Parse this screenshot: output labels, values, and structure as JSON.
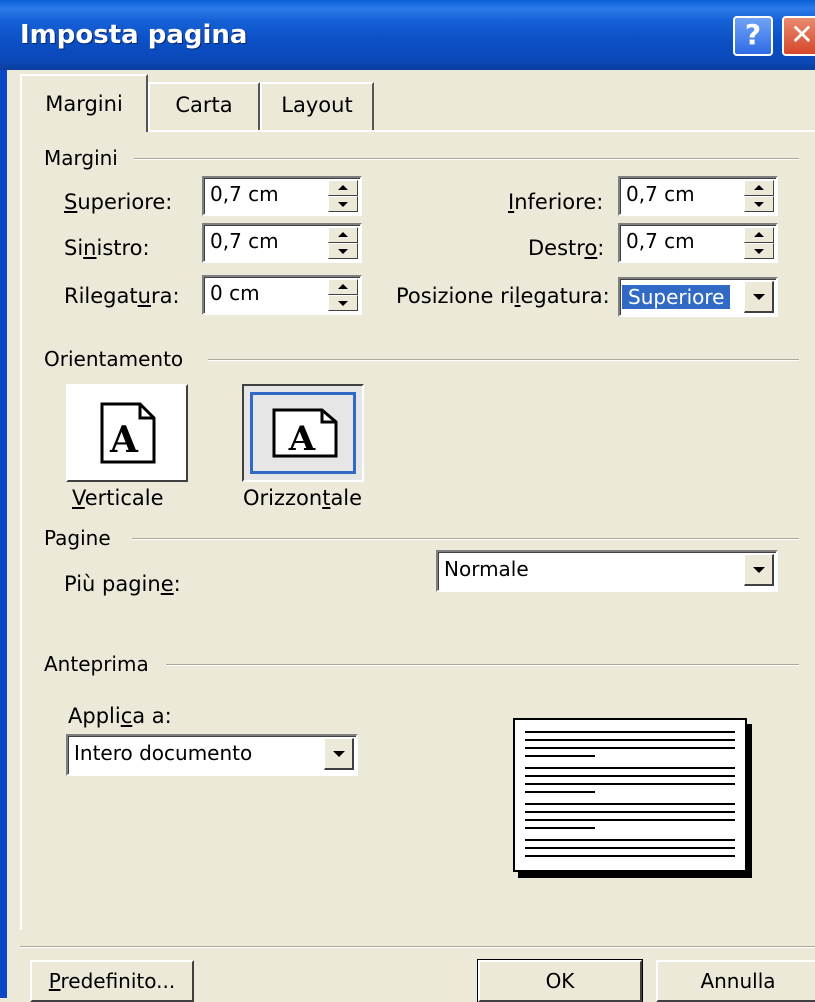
{
  "window": {
    "title": "Imposta pagina",
    "help_glyph": "?",
    "close_glyph": "✕"
  },
  "tabs": [
    {
      "label": "Margini",
      "active": true
    },
    {
      "label": "Carta",
      "active": false
    },
    {
      "label": "Layout",
      "active": false
    }
  ],
  "margini": {
    "header": "Margini",
    "superiore": {
      "label_pre": "",
      "label_ul": "S",
      "label_post": "uperiore:",
      "value": "0,7 cm"
    },
    "sinistro": {
      "label_pre": "Si",
      "label_ul": "n",
      "label_post": "istro:",
      "value": "0,7 cm"
    },
    "rilegatura": {
      "label_pre": "Rilegat",
      "label_ul": "u",
      "label_post": "ra:",
      "value": "0 cm"
    },
    "inferiore": {
      "label_pre": "",
      "label_ul": "I",
      "label_post": "nferiore:",
      "value": "0,7 cm"
    },
    "destro": {
      "label_pre": "Destr",
      "label_ul": "o",
      "label_post": ":",
      "value": "0,7 cm"
    },
    "posizione": {
      "label_pre": "Posizione ri",
      "label_ul": "l",
      "label_post": "egatura:",
      "value": "Superiore"
    }
  },
  "orientamento": {
    "header": "Orientamento",
    "verticale": {
      "label_pre": "",
      "label_ul": "V",
      "label_post": "erticale",
      "glyph": "A"
    },
    "orizzontale": {
      "label_pre": "Orizzon",
      "label_ul": "t",
      "label_post": "ale",
      "glyph": "A"
    }
  },
  "pagine": {
    "header": "Pagine",
    "piu_pagine": {
      "label_pre": "Più pagin",
      "label_ul": "e",
      "label_post": ":",
      "value": "Normale"
    }
  },
  "anteprima": {
    "header": "Anteprima",
    "applica": {
      "label_pre": "Appli",
      "label_ul": "c",
      "label_post": "a a:",
      "value": "Intero documento"
    }
  },
  "buttons": {
    "predefinito": {
      "label_pre": "",
      "label_ul": "P",
      "label_post": "redefinito..."
    },
    "ok": "OK",
    "annulla": "Annulla"
  }
}
